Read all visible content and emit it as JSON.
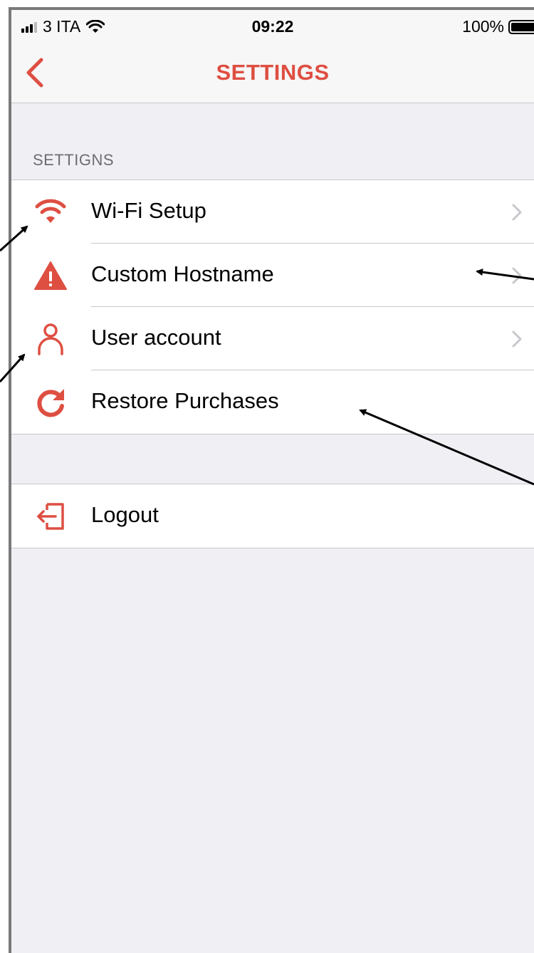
{
  "status_bar": {
    "carrier": "3 ITA",
    "time": "09:22",
    "battery": "100%"
  },
  "nav": {
    "title": "SETTINGS",
    "back_icon": "chevron-left-icon"
  },
  "section": {
    "header": "SETTIGNS"
  },
  "settings_items": [
    {
      "label": "Wi-Fi Setup",
      "icon": "wifi-icon",
      "chevron": true
    },
    {
      "label": "Custom Hostname",
      "icon": "warning-icon",
      "chevron": true
    },
    {
      "label": "User account",
      "icon": "user-icon",
      "chevron": true
    },
    {
      "label": "Restore Purchases",
      "icon": "refresh-icon",
      "chevron": false
    }
  ],
  "logout": {
    "label": "Logout",
    "icon": "logout-icon"
  },
  "colors": {
    "accent": "#de4f42",
    "background": "#efeff4",
    "separator": "#c8c7cc"
  }
}
